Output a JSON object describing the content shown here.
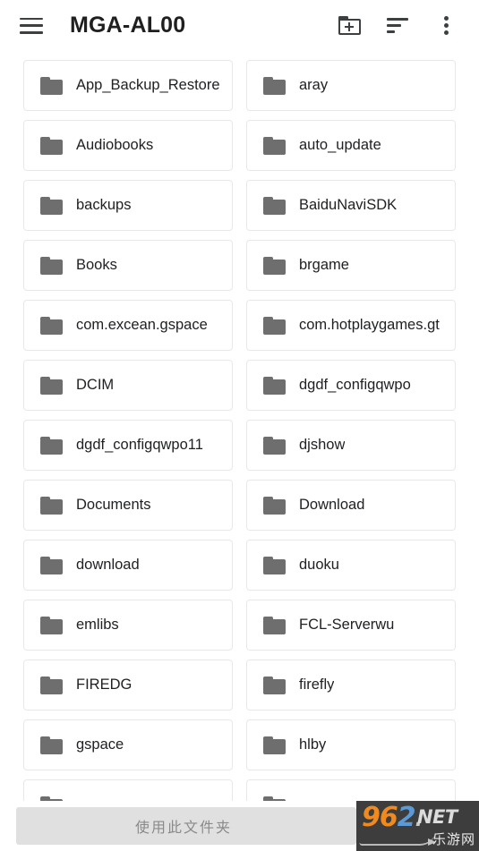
{
  "appbar": {
    "menu_icon": "hamburger-menu-icon",
    "title": "MGA-AL00",
    "new_folder_icon": "folder-add-icon",
    "sort_icon": "sort-icon",
    "overflow_icon": "more-vertical-icon"
  },
  "folders": [
    {
      "name": ""
    },
    {
      "name": ""
    },
    {
      "name": "App_Backup_Restore"
    },
    {
      "name": "aray"
    },
    {
      "name": "Audiobooks"
    },
    {
      "name": "auto_update"
    },
    {
      "name": "backups"
    },
    {
      "name": "BaiduNaviSDK"
    },
    {
      "name": "Books"
    },
    {
      "name": "brgame"
    },
    {
      "name": "com.excean.gspace"
    },
    {
      "name": "com.hotplaygames.gt"
    },
    {
      "name": "DCIM"
    },
    {
      "name": "dgdf_configqwpo"
    },
    {
      "name": "dgdf_configqwpo11"
    },
    {
      "name": "djshow"
    },
    {
      "name": "Documents"
    },
    {
      "name": "Download"
    },
    {
      "name": "download"
    },
    {
      "name": "duoku"
    },
    {
      "name": "emlibs"
    },
    {
      "name": "FCL-Serverwu"
    },
    {
      "name": "FIREDG"
    },
    {
      "name": "firefly"
    },
    {
      "name": "gspace"
    },
    {
      "name": "hlby"
    },
    {
      "name": ""
    },
    {
      "name": ""
    }
  ],
  "bottom": {
    "use_folder_label": "使用此文件夹"
  },
  "watermark": {
    "digit_9": "9",
    "digit_6": "6",
    "digit_2": "2",
    "dot": ".",
    "net": "NET",
    "cn_text": "乐游网"
  },
  "colors": {
    "folder_icon": "#6e6e6e",
    "card_border": "#e8e8e8",
    "text": "#202124",
    "icon": "#3c4043",
    "bottom_button_bg": "#e0e0e0",
    "bottom_button_text": "#8a8a8a",
    "watermark_bg": "#3d3d3d",
    "watermark_orange": "#f08a1e",
    "watermark_blue": "#5b9ad6"
  }
}
